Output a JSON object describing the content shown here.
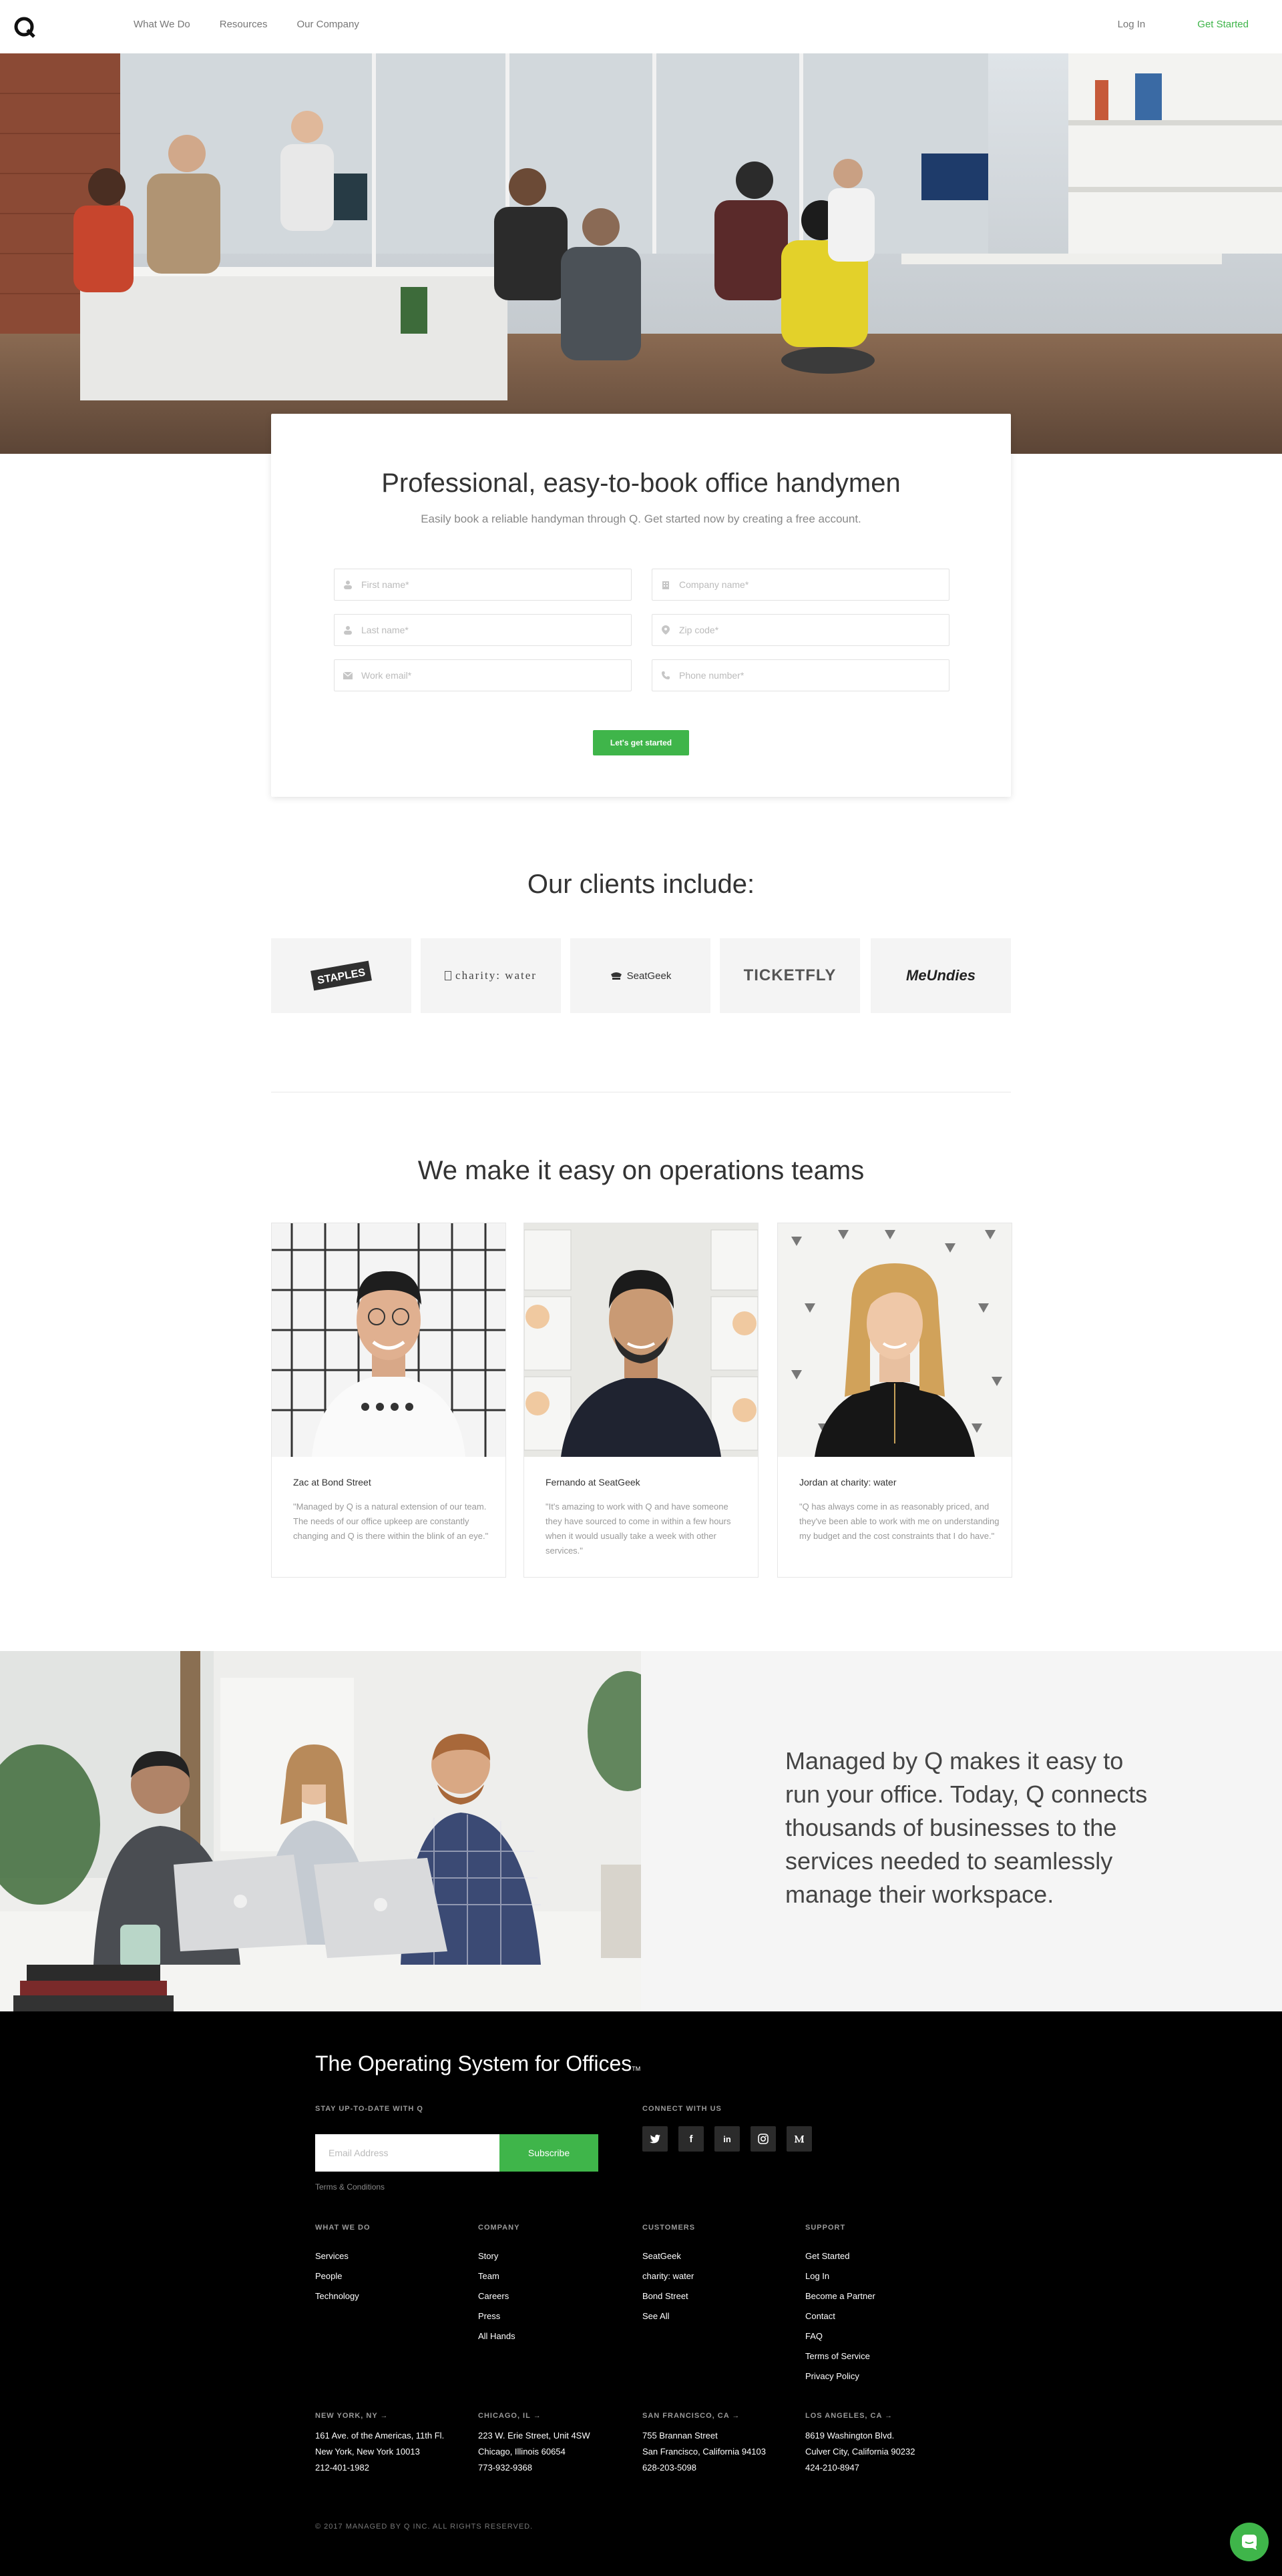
{
  "nav": {
    "logo": "Q",
    "links": [
      "What We Do",
      "Resources",
      "Our Company"
    ],
    "login": "Log In",
    "get_started": "Get Started"
  },
  "signup": {
    "title": "Professional, easy-to-book office handymen",
    "subtitle": "Easily book a reliable handyman through Q. Get started now by creating a free account.",
    "fields": {
      "first_name": "First name*",
      "company_name": "Company name*",
      "last_name": "Last name*",
      "zip_code": "Zip code*",
      "work_email": "Work email*",
      "phone_number": "Phone number*"
    },
    "button": "Let's get started"
  },
  "clients": {
    "title": "Our clients include:",
    "logos": [
      "STAPLES",
      "charity: water",
      "SeatGeek",
      "TICKETFLY",
      "MeUndies"
    ]
  },
  "testimonials": {
    "title": "We make it easy on operations teams",
    "items": [
      {
        "name": "Zac at Bond Street",
        "quote": "\"Managed by Q is a natural extension of our team. The needs of our office upkeep are constantly changing and Q is there within the blink of an eye.\""
      },
      {
        "name": "Fernando at SeatGeek",
        "quote": "\"It's amazing to work with Q and have someone they have sourced to come in within a few hours when it would usually take a week with other services.\""
      },
      {
        "name": "Jordan at charity: water",
        "quote": "\"Q has always come in as reasonably priced, and they've been able to work with me on understanding my budget and the cost constraints that I do have.\""
      }
    ]
  },
  "about": {
    "text": "Managed by Q makes it easy to run your office. Today, Q connects thousands of businesses to the services needed to seamlessly manage their workspace."
  },
  "footer": {
    "tagline": "The Operating System for Offices",
    "tm": "TM",
    "stay_heading": "STAY UP-TO-DATE WITH Q",
    "email_placeholder": "Email Address",
    "subscribe": "Subscribe",
    "terms": "Terms & Conditions",
    "connect_heading": "CONNECT WITH US",
    "social_icons": [
      "twitter-icon",
      "facebook-icon",
      "linkedin-icon",
      "instagram-icon",
      "medium-icon"
    ],
    "columns": [
      {
        "heading": "WHAT WE DO",
        "items": [
          "Services",
          "People",
          "Technology"
        ]
      },
      {
        "heading": "COMPANY",
        "items": [
          "Story",
          "Team",
          "Careers",
          "Press",
          "All Hands"
        ]
      },
      {
        "heading": "CUSTOMERS",
        "items": [
          "SeatGeek",
          "charity: water",
          "Bond Street",
          "See All"
        ]
      },
      {
        "heading": "SUPPORT",
        "items": [
          "Get Started",
          "Log In",
          "Become a Partner",
          "Contact",
          "FAQ",
          "Terms of Service",
          "Privacy Policy"
        ]
      }
    ],
    "offices": [
      {
        "city": "NEW YORK, NY →",
        "line1": "161 Ave. of the Americas, 11th Fl.",
        "line2": "New York, New York 10013",
        "phone": "212-401-1982"
      },
      {
        "city": "CHICAGO, IL →",
        "line1": "223 W. Erie Street, Unit 4SW",
        "line2": "Chicago, Illinois 60654",
        "phone": "773-932-9368"
      },
      {
        "city": "SAN FRANCISCO, CA →",
        "line1": "755 Brannan Street",
        "line2": "San Francisco, California 94103",
        "phone": "628-203-5098"
      },
      {
        "city": "LOS ANGELES, CA →",
        "line1": "8619 Washington Blvd.",
        "line2": "Culver City, California 90232",
        "phone": "424-210-8947"
      }
    ],
    "copyright": "© 2017 MANAGED BY Q INC. ALL RIGHTS RESERVED."
  },
  "colors": {
    "accent": "#3fb54a",
    "footer_bg": "#000000",
    "text": "#333333"
  }
}
